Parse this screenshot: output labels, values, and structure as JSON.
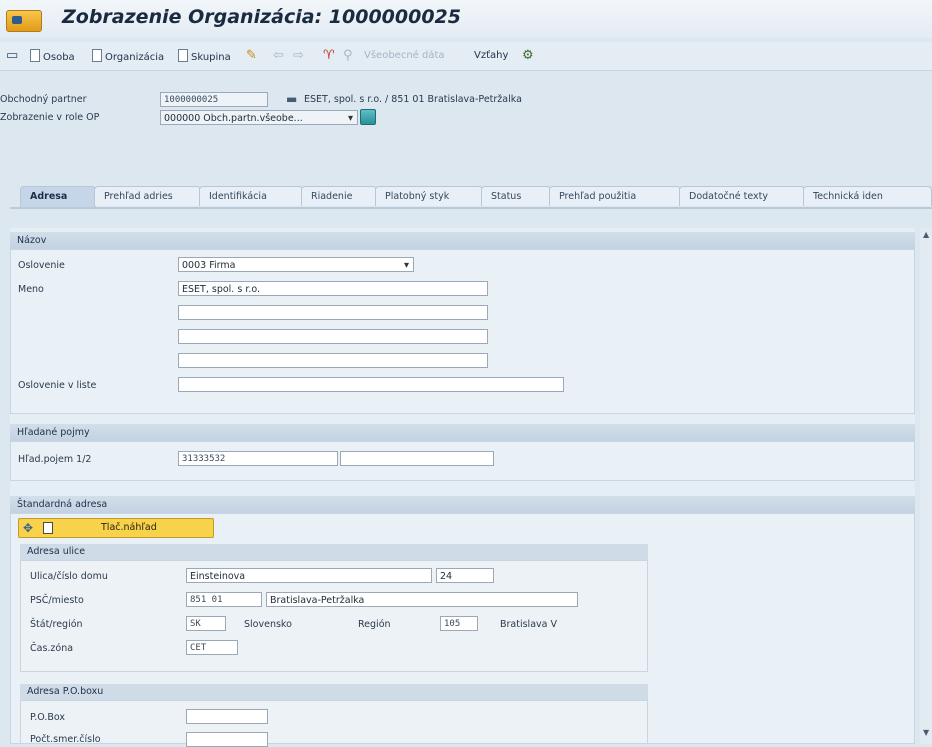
{
  "title": "Zobrazenie Organizácia: 1000000025",
  "toolbar": {
    "osoba": "Osoba",
    "organizacia": "Organizácia",
    "skupina": "Skupina",
    "vseobecne_data": "Všeobecné dáta",
    "vztahy": "Vzťahy"
  },
  "header": {
    "partner_label": "Obchodný partner",
    "partner_value": "1000000025",
    "partner_desc": "ESET, spol. s r.o. / 851 01 Bratislava-Petržalka",
    "role_label": "Zobrazenie v role OP",
    "role_value": "000000 Obch.partn.všeobe..."
  },
  "tabs": [
    "Adresa",
    "Prehľad adries",
    "Identifikácia",
    "Riadenie",
    "Platobný styk",
    "Status",
    "Prehľad použitia",
    "Dodatočné texty",
    "Technická iden"
  ],
  "nazov": {
    "heading": "Názov",
    "oslovenie_label": "Oslovenie",
    "oslovenie_value": "0003 Firma",
    "meno_label": "Meno",
    "meno_value": "ESET, spol. s r.o.",
    "oslovenie_list_label": "Oslovenie v liste"
  },
  "hladane": {
    "heading": "Hľadané pojmy",
    "label": "Hľad.pojem 1/2",
    "value1": "31333532"
  },
  "adresa": {
    "heading": "Štandardná adresa",
    "print_button": "Tlač.náhľad",
    "ulice_heading": "Adresa ulice",
    "ulica_label": "Ulica/číslo domu",
    "ulica_value": "Einsteinova",
    "cislo_value": "24",
    "psc_label": "PSČ/miesto",
    "psc_value": "851 01",
    "miesto_value": "Bratislava-Petržalka",
    "stat_label": "Štát/región",
    "stat_value": "SK",
    "stat_name": "Slovensko",
    "region_label": "Región",
    "region_value": "105",
    "region_name": "Bratislava V",
    "zona_label": "Čas.zóna",
    "zona_value": "CET",
    "pobox_heading": "Adresa P.O.boxu",
    "pobox_label": "P.O.Box",
    "pobox_cislo_label": "Počt.smer.číslo"
  }
}
